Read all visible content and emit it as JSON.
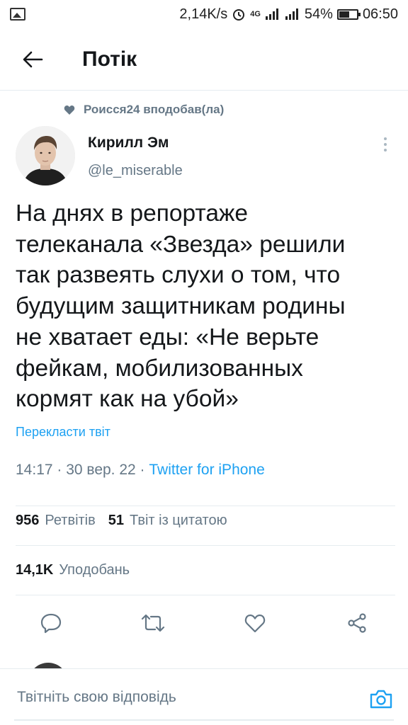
{
  "status_bar": {
    "speed": "2,14K/s",
    "network": "4G",
    "battery_percent": "54%",
    "battery_level": 0.54,
    "time": "06:50"
  },
  "header": {
    "title": "Потік"
  },
  "tweet": {
    "social_context": "Роисся24 вподобав(ла)",
    "author_name": "Кирилл Эм",
    "author_handle": "@le_miserable",
    "text": "На днях в репортаже\nтелеканала «Звезда» решили\nтак развеять слухи о том, что\nбудущим защитникам родины\nне хватает еды: «Не верьте\nфейкам, мобилизованных\nкормят как на убой»",
    "translate_label": "Перекласти твіт",
    "timestamp": "14:17 · 30 вер. 22 · ",
    "source": "Twitter for iPhone",
    "retweets_count": "956",
    "retweets_label": "Ретвітів",
    "quotes_count": "51",
    "quotes_label": "Твіт із цитатою",
    "likes_count": "14,1K",
    "likes_label": "Уподобань"
  },
  "actions": {
    "reply_icon": "reply-icon",
    "retweet_icon": "retweet-icon",
    "like_icon": "heart-icon",
    "share_icon": "share-icon"
  },
  "reply_bar": {
    "placeholder": "Твітніть свою відповідь"
  },
  "colors": {
    "accent": "#1da1f2",
    "secondary_text": "#657786",
    "primary_text": "#14171a",
    "divider": "#e6ecf0"
  }
}
